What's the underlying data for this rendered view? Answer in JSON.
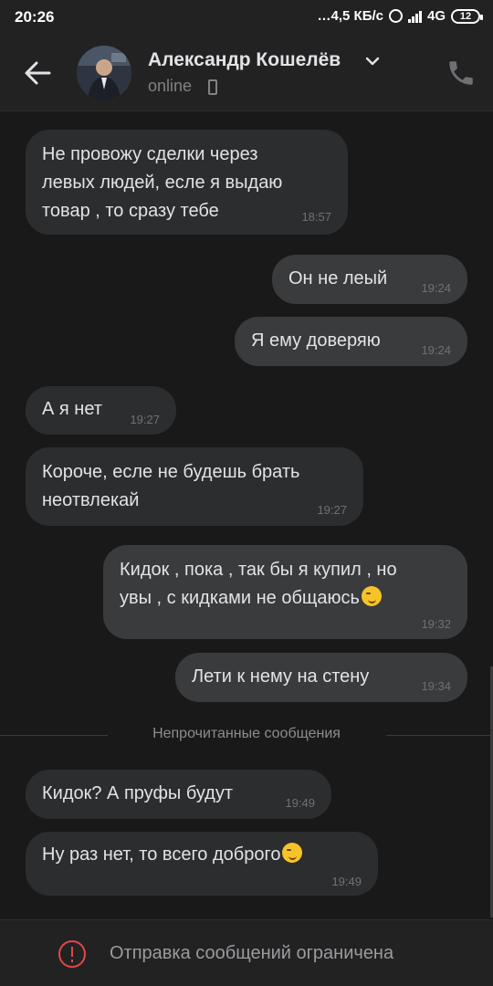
{
  "status_bar": {
    "time": "20:26",
    "network_speed": "…4,5 КБ/с",
    "network_type": "4G",
    "battery": "12"
  },
  "header": {
    "contact_name": "Александр Кошелёв",
    "status": "online",
    "icons": {
      "back": "arrow-left-icon",
      "call": "phone-icon",
      "device": "mobile-device-icon"
    }
  },
  "messages": [
    {
      "direction": "in",
      "text": "Не провожу сделки через\nлевых людей, есле я выдаю\nтовар , то сразу тебе",
      "time": "18:57"
    },
    {
      "direction": "out",
      "text": "Он не леый",
      "time": "19:24"
    },
    {
      "direction": "out",
      "text": "Я ему доверяю",
      "time": "19:24"
    },
    {
      "direction": "in",
      "text": "А я нет",
      "time": "19:27"
    },
    {
      "direction": "in",
      "text": "Короче, есле не будешь брать\nнеотвлекай",
      "time": "19:27"
    },
    {
      "direction": "out",
      "text": "Кидок , пока , так бы я купил , но\nувы , с кидками не общаюсь",
      "time": "19:32",
      "emoji": "smirking-face"
    },
    {
      "direction": "out",
      "text": "Лети к нему на стену",
      "time": "19:34"
    },
    {
      "direction": "in",
      "text": "Кидок? А пруфы будут",
      "time": "19:49"
    },
    {
      "direction": "in",
      "text": "Ну раз нет, то всего доброго",
      "time": "19:49",
      "emoji": "smirking-face"
    }
  ],
  "unread_divider": "Непрочитанные сообщения",
  "footer": {
    "notice": "Отправка сообщений ограничена",
    "icon": "warning-circle-icon",
    "accent": "#e64646"
  }
}
